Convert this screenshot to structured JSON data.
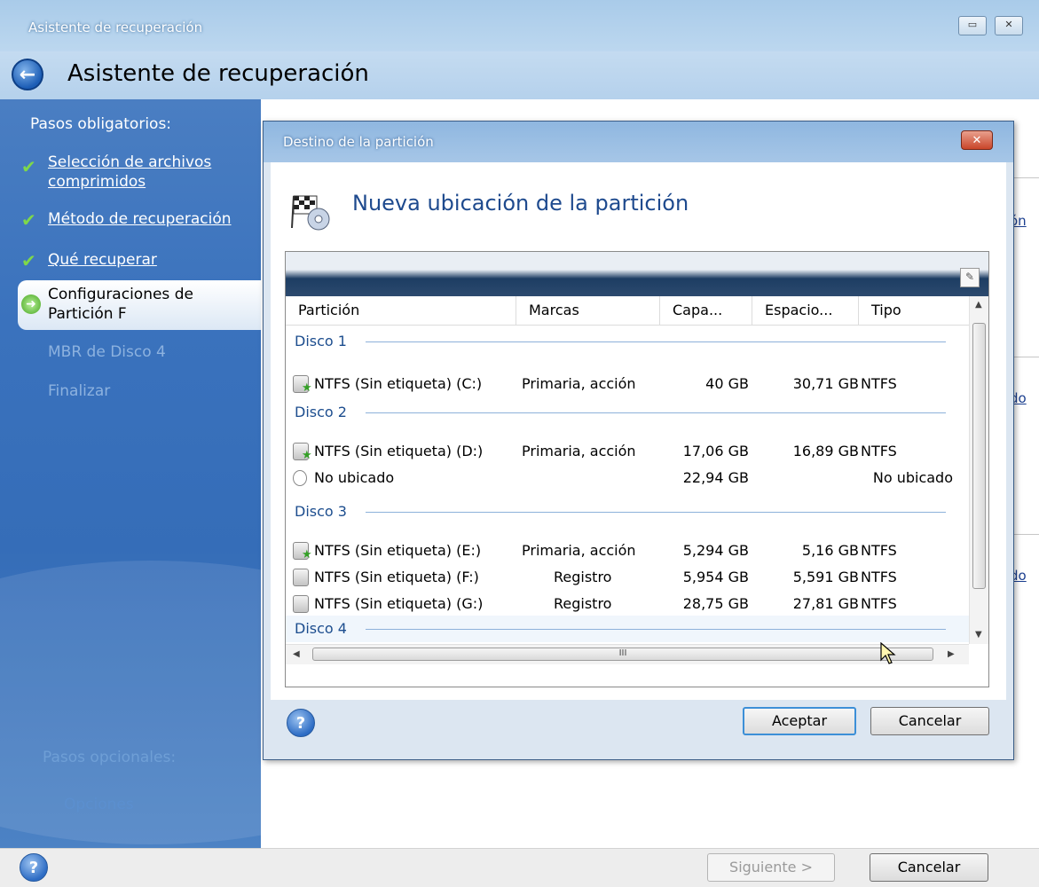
{
  "window": {
    "titlebar_title": "Asistente de recuperación",
    "header_title": "Asistente de recuperación",
    "restore_icon": "restore-icon",
    "close_icon": "close-icon"
  },
  "sidebar": {
    "required_title": "Pasos obligatorios:",
    "steps": [
      {
        "label": "Selección de archivos comprimidos",
        "state": "done"
      },
      {
        "label": "Método de recuperación",
        "state": "done"
      },
      {
        "label": "Qué recuperar",
        "state": "done"
      },
      {
        "label": "Configuraciones de Partición F",
        "state": "current"
      },
      {
        "label": "MBR de Disco 4",
        "state": "disabled"
      },
      {
        "label": "Finalizar",
        "state": "disabled"
      }
    ],
    "optional_title": "Pasos opcionales:",
    "optional_items": [
      "Opciones"
    ]
  },
  "background_links": [
    "ón",
    "do",
    "do"
  ],
  "dialog": {
    "title": "Destino de la partición",
    "heading": "Nueva ubicación de la partición",
    "columns": [
      "Partición",
      "Marcas",
      "Capa...",
      "Espacio...",
      "Tipo"
    ],
    "groups": [
      {
        "label": "Disco 1",
        "rows": [
          {
            "name": "NTFS (Sin etiqueta) (C:)",
            "flags": "Primaria, acción",
            "capacity": "40 GB",
            "free": "30,71 GB",
            "type": "NTFS",
            "icon": "active-partition-icon"
          }
        ]
      },
      {
        "label": "Disco 2",
        "rows": [
          {
            "name": "NTFS (Sin etiqueta) (D:)",
            "flags": "Primaria, acción",
            "capacity": "17,06 GB",
            "free": "16,89 GB",
            "type": "NTFS",
            "icon": "active-partition-icon"
          },
          {
            "name": "No ubicado",
            "flags": "",
            "capacity": "22,94 GB",
            "free": "",
            "type": "No ubicado",
            "icon": "unallocated-icon"
          }
        ]
      },
      {
        "label": "Disco 3",
        "rows": [
          {
            "name": "NTFS (Sin etiqueta) (E:)",
            "flags": "Primaria, acción",
            "capacity": "5,294 GB",
            "free": "5,16 GB",
            "type": "NTFS",
            "icon": "active-partition-icon"
          },
          {
            "name": "NTFS (Sin etiqueta) (F:)",
            "flags": "Registro",
            "capacity": "5,954 GB",
            "free": "5,591 GB",
            "type": "NTFS",
            "icon": "partition-icon"
          },
          {
            "name": "NTFS (Sin etiqueta) (G:)",
            "flags": "Registro",
            "capacity": "28,75 GB",
            "free": "27,81 GB",
            "type": "NTFS",
            "icon": "partition-icon"
          }
        ]
      },
      {
        "label": "Disco 4",
        "rows": []
      }
    ],
    "hscroll_grip": "III",
    "ok_label": "Aceptar",
    "cancel_label": "Cancelar"
  },
  "footer": {
    "next_label": "Siguiente >",
    "cancel_label": "Cancelar"
  },
  "colors": {
    "sidebar": "#3a72bd",
    "heading": "#1e4a8e",
    "group": "#1c4d8e",
    "default_button_border": "#3c8fd7"
  }
}
